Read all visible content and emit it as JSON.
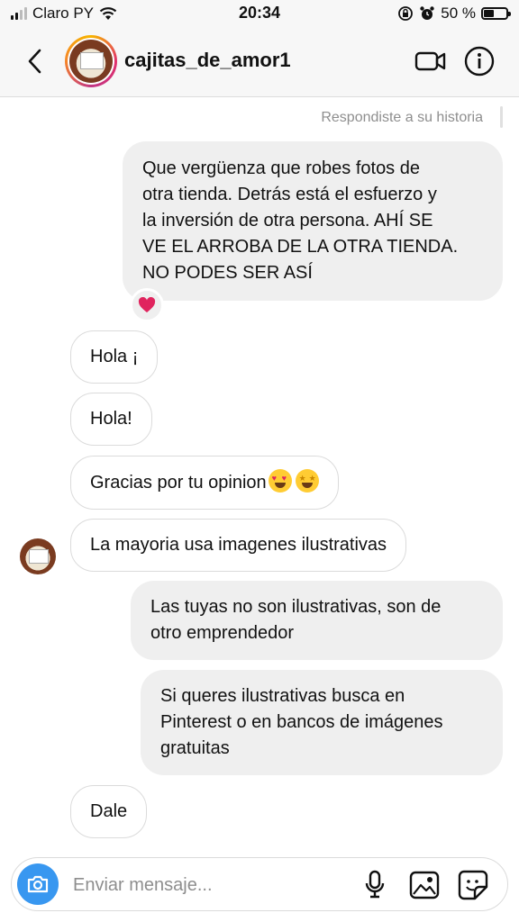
{
  "status_bar": {
    "carrier": "Claro PY",
    "time": "20:34",
    "battery": "50 %",
    "battery_level": 0.5
  },
  "header": {
    "username": "cajitas_de_amor1",
    "icons": [
      "back-chevron-icon",
      "video-call-icon",
      "info-icon"
    ]
  },
  "chat": {
    "story_note": "Respondiste a su historia",
    "messages": [
      {
        "from": "me",
        "text": "Que vergüenza que robes fotos de otra tienda. Detrás está el esfuerzo y la inversión de otra persona. AHÍ SE VE EL ARROBA DE LA OTRA TIENDA. NO PODES SER ASÍ",
        "lines": [
          "Que vergüenza que robes fotos de",
          "otra tienda. Detrás está el esfuerzo y",
          "la inversión de otra persona. AHÍ SE",
          "VE EL ARROBA DE LA OTRA TIENDA.",
          "NO PODES SER ASÍ"
        ],
        "reaction": "heart"
      },
      {
        "from": "them",
        "text": "Hola ¡"
      },
      {
        "from": "them",
        "text": "Hola!"
      },
      {
        "from": "them",
        "text": "Gracias por tu opinion",
        "emojis": [
          "heart-eyes-emoji",
          "star-struck-emoji"
        ]
      },
      {
        "from": "them",
        "text": "La mayoria usa imagenes ilustrativas"
      },
      {
        "from": "me",
        "text": "Las tuyas no son ilustrativas, son de otro emprendedor",
        "lines": [
          "Las tuyas no son ilustrativas, son de",
          "otro emprendedor"
        ]
      },
      {
        "from": "me",
        "text": "Si queres ilustrativas busca en Pinterest o en bancos de imágenes gratuitas",
        "lines": [
          "Si queres ilustrativas busca en",
          "Pinterest o en bancos de imágenes",
          "gratuitas"
        ]
      },
      {
        "from": "them",
        "text": "Dale"
      }
    ]
  },
  "composer": {
    "placeholder": "Enviar mensaje...",
    "icons": [
      "camera-icon",
      "microphone-icon",
      "gallery-icon",
      "sticker-icon"
    ],
    "accent": "#3897f0"
  }
}
